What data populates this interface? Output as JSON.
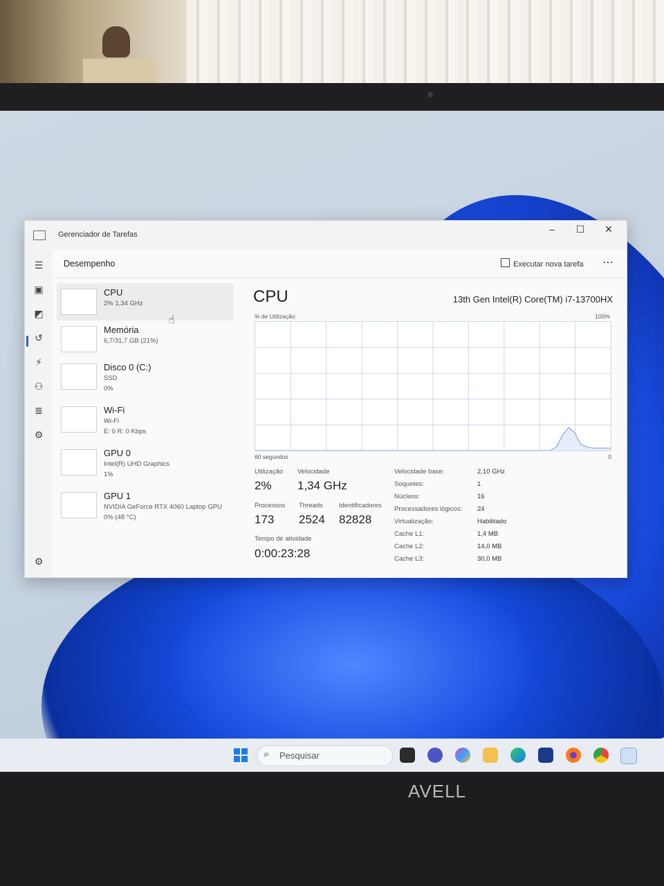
{
  "window": {
    "title": "Gerenciador de Tarefas",
    "minimize": "–",
    "maximize": "☐",
    "close": "✕"
  },
  "header": {
    "section": "Desempenho",
    "run_task": "Executar nova tarefa",
    "more": "⋯"
  },
  "perf_items": [
    {
      "name": "CPU",
      "line1": "2% 1,34 GHz",
      "line2": ""
    },
    {
      "name": "Memória",
      "line1": "6,7/31,7 GB (21%)",
      "line2": ""
    },
    {
      "name": "Disco 0 (C:)",
      "line1": "SSD",
      "line2": "0%"
    },
    {
      "name": "Wi-Fi",
      "line1": "Wi-Fi",
      "line2": "E: 0 R: 0 Kbps"
    },
    {
      "name": "GPU 0",
      "line1": "Intel(R) UHD Graphics",
      "line2": "1%"
    },
    {
      "name": "GPU 1",
      "line1": "NVIDIA GeForce RTX 4060 Laptop GPU",
      "line2": "0% (48 °C)"
    }
  ],
  "detail": {
    "title": "CPU",
    "model": "13th Gen Intel(R) Core(TM) i7-13700HX",
    "graph_label": "% de Utilização",
    "graph_max": "100%",
    "graph_time": "60 segundos",
    "graph_min": "0",
    "stats": {
      "util_label": "Utilização",
      "util_value": "2%",
      "speed_label": "Velocidade",
      "speed_value": "1,34 GHz",
      "proc_label": "Processos",
      "proc_value": "173",
      "threads_label": "Threads",
      "threads_value": "2524",
      "handles_label": "Identificadores",
      "handles_value": "82828",
      "uptime_label": "Tempo de atividade",
      "uptime_value": "0:00:23:28"
    },
    "specs": [
      {
        "k": "Velocidade base:",
        "v": "2,10 GHz"
      },
      {
        "k": "Soquetes:",
        "v": "1"
      },
      {
        "k": "Núcleos:",
        "v": "16"
      },
      {
        "k": "Processadores lógicos:",
        "v": "24"
      },
      {
        "k": "Virtualização:",
        "v": "Habilitado"
      },
      {
        "k": "Cache L1:",
        "v": "1,4 MB"
      },
      {
        "k": "Cache L2:",
        "v": "14,0 MB"
      },
      {
        "k": "Cache L3:",
        "v": "30,0 MB"
      }
    ],
    "usage_samples": [
      0,
      0,
      0,
      0,
      0,
      0,
      0,
      0,
      0,
      0,
      0,
      0,
      0,
      0,
      0,
      0,
      0,
      0,
      0,
      0,
      0,
      0,
      0,
      0,
      0,
      0,
      0,
      0,
      0,
      0,
      0,
      0,
      0,
      0,
      0,
      0,
      0,
      0,
      0,
      0,
      0,
      0,
      0,
      0,
      0,
      0,
      0,
      0,
      0,
      0,
      3,
      12,
      18,
      14,
      5,
      3,
      2,
      2,
      2,
      2
    ]
  },
  "taskbar": {
    "search_placeholder": "Pesquisar",
    "search_icon": "search-icon"
  },
  "laptop": {
    "brand": "AVELL"
  },
  "colors": {
    "accent": "#2b62c8",
    "graph_line": "#8aa6d6",
    "graph_border": "#cfd8e6"
  }
}
